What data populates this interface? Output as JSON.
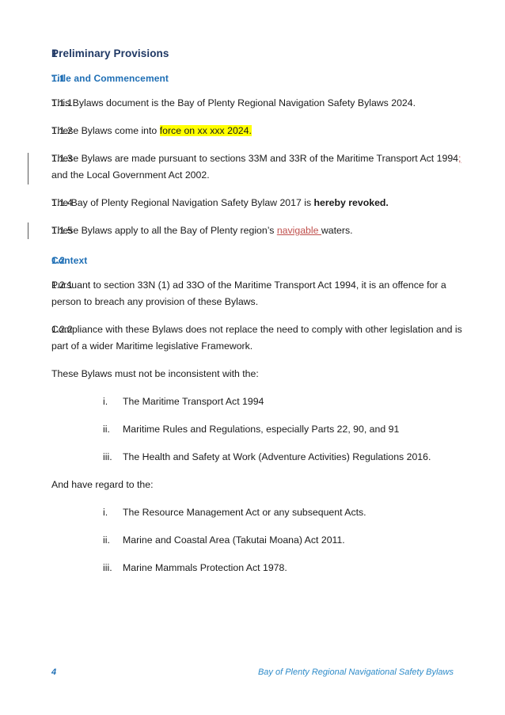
{
  "document": {
    "section_number": "1",
    "section_title": "Preliminary Provisions"
  },
  "subsections": {
    "s11": {
      "number": "1.1",
      "title": "Title and Commencement"
    },
    "s12": {
      "number": "1.2",
      "title": "Context"
    }
  },
  "clauses": {
    "c111": {
      "number": "1.1.1",
      "text": "This Bylaws document is the Bay of Plenty Regional Navigation Safety Bylaws 2024."
    },
    "c112": {
      "number": "1.1.2",
      "text_before": "These Bylaws come into ",
      "highlighted": "force on xx xxx 2024."
    },
    "c113": {
      "number": "1.1.3",
      "text_before": "These Bylaws are made pursuant to sections 33M and 33R of the Maritime Transport Act 1994",
      "inserted": ";",
      "text_after": " and the Local Government Act 2002."
    },
    "c114": {
      "number": "1.1.4",
      "text_before": "The Bay of Plenty Regional Navigation Safety Bylaw 2017 is ",
      "bold": "hereby revoked."
    },
    "c115": {
      "number": "1.1.5",
      "text_before": "These Bylaws apply to all the Bay of Plenty region’s ",
      "inserted": "navigable ",
      "text_after": "waters."
    },
    "c121": {
      "number": "1.2.1",
      "text": "Pursuant to section 33N (1) ad 33O of the Maritime Transport Act 1994, it is an offence for a person to breach any provision of these Bylaws."
    },
    "c122": {
      "number": "1.2.2",
      "text": "Compliance with these Bylaws does not replace the need to comply with other legislation and is part of a wider Maritime legislative Framework.",
      "intro_1": "These Bylaws must not be inconsistent with the:",
      "intro_2": "And have regard to the:"
    }
  },
  "list_one": {
    "items": [
      {
        "marker": "i.",
        "text": "The Maritime Transport Act 1994"
      },
      {
        "marker": "ii.",
        "text": "Maritime Rules and Regulations, especially Parts 22, 90, and 91"
      },
      {
        "marker": "iii.",
        "text": "The Health and Safety at Work (Adventure Activities) Regulations 2016."
      }
    ]
  },
  "list_two": {
    "items": [
      {
        "marker": "i.",
        "text": "The Resource Management Act or any subsequent Acts."
      },
      {
        "marker": "ii.",
        "text": "Marine and Coastal Area (Takutai Moana) Act 2011."
      },
      {
        "marker": "iii.",
        "text": "Marine Mammals Protection Act 1978."
      }
    ]
  },
  "footer": {
    "page_number": "4",
    "title": "Bay of Plenty Regional Navigational Safety Bylaws"
  },
  "colors": {
    "heading_level1": "#1f3864",
    "heading_level2": "#1f6fb5",
    "tracked_insertion": "#c0504d",
    "highlight": "#ffff00",
    "footer_title": "#2e8bc9",
    "body_text": "#1a1a1a",
    "change_bar": "#5a5a5a"
  }
}
